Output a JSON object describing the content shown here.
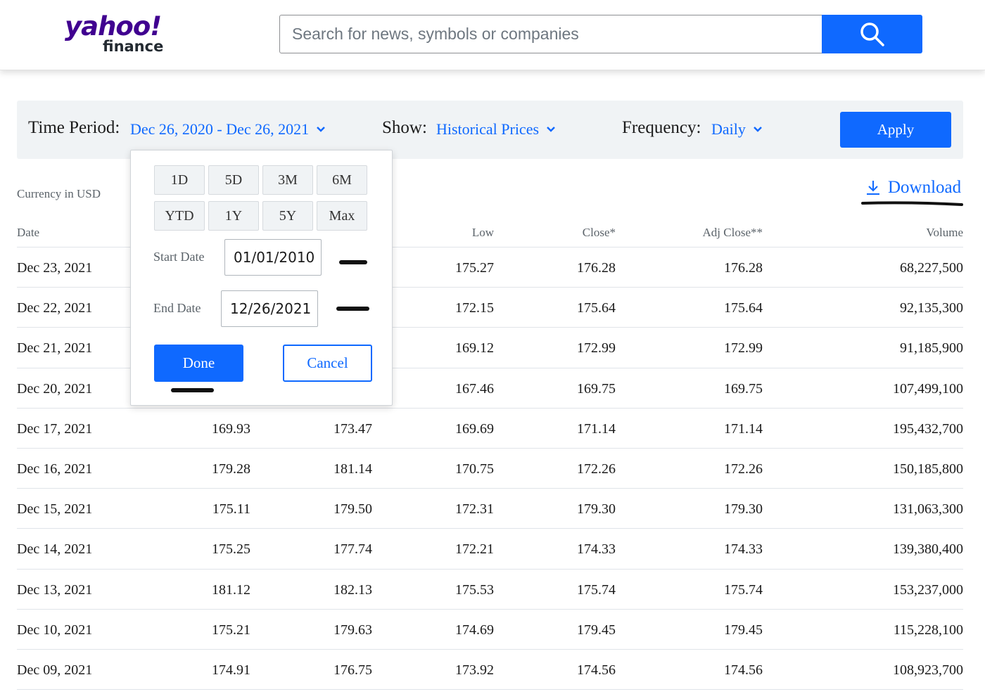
{
  "logo": {
    "top": "yahoo!",
    "bottom": "finance"
  },
  "search": {
    "placeholder": "Search for news, symbols or companies"
  },
  "filters": {
    "time_period_label": "Time Period:",
    "time_period_value": "Dec 26, 2020 - Dec 26, 2021",
    "show_label": "Show:",
    "show_value": "Historical Prices",
    "frequency_label": "Frequency:",
    "frequency_value": "Daily",
    "apply_label": "Apply"
  },
  "currency": "Currency in USD",
  "download_label": "Download",
  "popover": {
    "presets": [
      "1D",
      "5D",
      "3M",
      "6M",
      "YTD",
      "1Y",
      "5Y",
      "Max"
    ],
    "start_label": "Start Date",
    "start_value": "01/01/2010",
    "end_label": "End Date",
    "end_value": "12/26/2021",
    "done_label": "Done",
    "cancel_label": "Cancel"
  },
  "table": {
    "headers": {
      "date": "Date",
      "low": "Low",
      "close": "Close*",
      "adj": "Adj Close**",
      "volume": "Volume"
    },
    "rows": [
      {
        "date": "Dec 23, 2021",
        "open": "",
        "high": "",
        "low": "175.27",
        "close": "176.28",
        "adj": "176.28",
        "volume": "68,227,500"
      },
      {
        "date": "Dec 22, 2021",
        "open": "",
        "high": "",
        "low": "172.15",
        "close": "175.64",
        "adj": "175.64",
        "volume": "92,135,300"
      },
      {
        "date": "Dec 21, 2021",
        "open": "",
        "high": "",
        "low": "169.12",
        "close": "172.99",
        "adj": "172.99",
        "volume": "91,185,900"
      },
      {
        "date": "Dec 20, 2021",
        "open": "",
        "high": "",
        "low": "167.46",
        "close": "169.75",
        "adj": "169.75",
        "volume": "107,499,100"
      },
      {
        "date": "Dec 17, 2021",
        "open": "169.93",
        "high": "173.47",
        "low": "169.69",
        "close": "171.14",
        "adj": "171.14",
        "volume": "195,432,700"
      },
      {
        "date": "Dec 16, 2021",
        "open": "179.28",
        "high": "181.14",
        "low": "170.75",
        "close": "172.26",
        "adj": "172.26",
        "volume": "150,185,800"
      },
      {
        "date": "Dec 15, 2021",
        "open": "175.11",
        "high": "179.50",
        "low": "172.31",
        "close": "179.30",
        "adj": "179.30",
        "volume": "131,063,300"
      },
      {
        "date": "Dec 14, 2021",
        "open": "175.25",
        "high": "177.74",
        "low": "172.21",
        "close": "174.33",
        "adj": "174.33",
        "volume": "139,380,400"
      },
      {
        "date": "Dec 13, 2021",
        "open": "181.12",
        "high": "182.13",
        "low": "175.53",
        "close": "175.74",
        "adj": "175.74",
        "volume": "153,237,000"
      },
      {
        "date": "Dec 10, 2021",
        "open": "175.21",
        "high": "179.63",
        "low": "174.69",
        "close": "179.45",
        "adj": "179.45",
        "volume": "115,228,100"
      },
      {
        "date": "Dec 09, 2021",
        "open": "174.91",
        "high": "176.75",
        "low": "173.92",
        "close": "174.56",
        "adj": "174.56",
        "volume": "108,923,700"
      }
    ]
  },
  "colors": {
    "accent": "#0f69ff",
    "brand": "#400090"
  },
  "icons": {
    "search": "search-icon",
    "chevron": "chevron-down-icon",
    "download": "download-icon"
  }
}
